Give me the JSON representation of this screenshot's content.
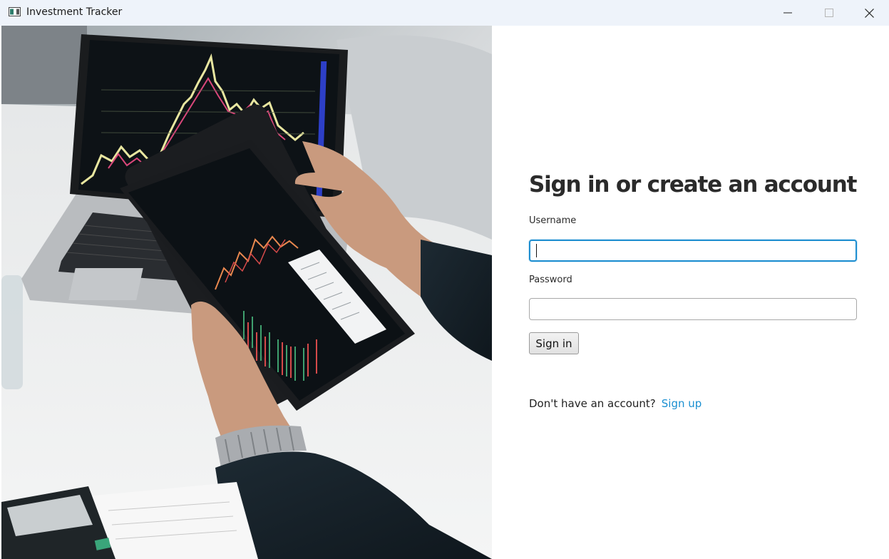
{
  "window": {
    "title": "Investment Tracker",
    "icon": "app-window-icon",
    "controls": {
      "minimize_icon": "minimize-icon",
      "maximize_icon": "maximize-icon",
      "close_icon": "close-icon"
    }
  },
  "form": {
    "heading": "Sign in or create an account",
    "username": {
      "label": "Username",
      "value": "",
      "placeholder": ""
    },
    "password": {
      "label": "Password",
      "value": "",
      "placeholder": ""
    },
    "submit_label": "Sign in",
    "signup_prompt": "Don't have an account?",
    "signup_link": "Sign up"
  },
  "colors": {
    "focus_border": "#1f8fd0",
    "link": "#1a8fd1",
    "titlebar": "#eef3fa",
    "heading": "#2b2b2b"
  }
}
